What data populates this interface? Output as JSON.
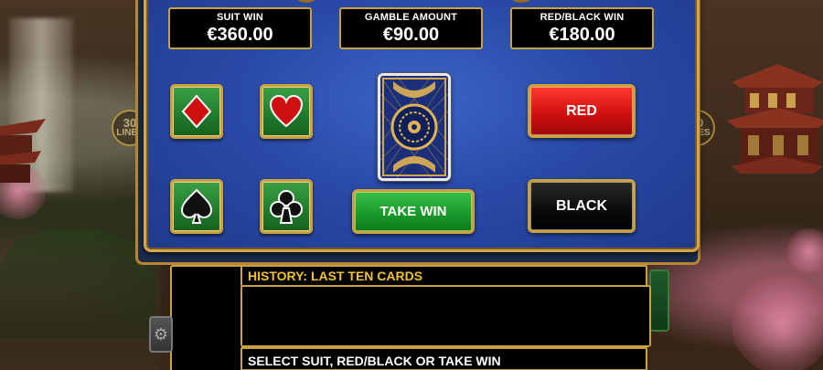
{
  "panel": {
    "suit_win_label": "SUIT WIN",
    "suit_win_value": "€360.00",
    "gamble_label": "GAMBLE AMOUNT",
    "gamble_value": "€90.00",
    "redblack_label": "RED/BLACK WIN",
    "redblack_value": "€180.00"
  },
  "suits": [
    {
      "name": "diamonds",
      "icon": "diamond-icon",
      "color": "#d01010"
    },
    {
      "name": "hearts",
      "icon": "heart-icon",
      "color": "#d01010"
    },
    {
      "name": "spades",
      "icon": "spade-icon",
      "color": "#111111"
    },
    {
      "name": "clubs",
      "icon": "club-icon",
      "color": "#111111"
    }
  ],
  "buttons": {
    "red": "RED",
    "black": "BLACK",
    "take_win": "TAKE WIN"
  },
  "history": {
    "title": "HISTORY: LAST TEN CARDS"
  },
  "status": {
    "message": "SELECT SUIT, RED/BLACK OR TAKE WIN"
  },
  "lines_badge": {
    "number": "30",
    "text": "LINES"
  },
  "colors": {
    "panel_blue": "#2a4aa8",
    "gold_border": "#c9a23e",
    "history_text": "#f2c12e",
    "red_button": "#d11010",
    "green_button": "#1a9a2a"
  }
}
